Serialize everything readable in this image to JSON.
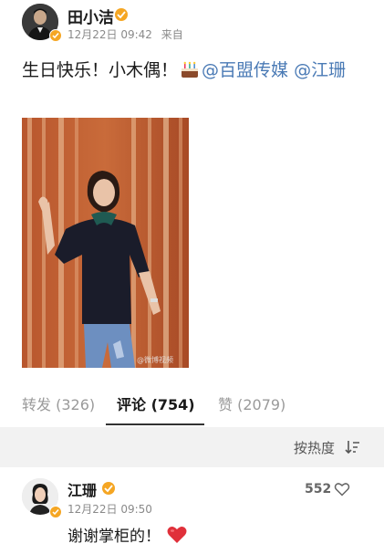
{
  "post": {
    "author": "田小洁",
    "date": "12月22日 09:42",
    "source": "来自",
    "text_plain": "生日快乐！小木偶！",
    "mention_1": "@百盟传媒",
    "mention_2": "@江珊",
    "emoji": "birthday-cake-icon",
    "photo_watermark": "@微博视频"
  },
  "tabs": [
    {
      "label": "转发 (326)"
    },
    {
      "label": "评论 (754)"
    },
    {
      "label": "赞 (2079)"
    }
  ],
  "active_tab": 1,
  "sort": {
    "label": "按热度"
  },
  "comment": {
    "author": "江珊",
    "date": "12月22日 09:50",
    "likes": "552",
    "text": "谢谢掌柜的！"
  },
  "colors": {
    "mention": "#4a7ab5",
    "verified": "#f5a623",
    "heart": "#e0303a",
    "sort_bar": "#f2f2f2"
  }
}
